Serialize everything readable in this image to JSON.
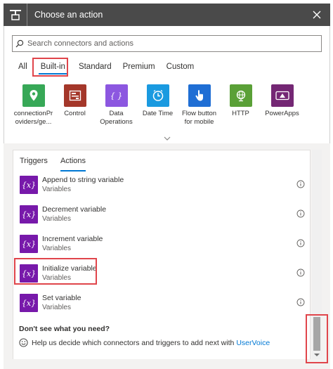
{
  "header": {
    "title": "Choose an action"
  },
  "search": {
    "placeholder": "Search connectors and actions",
    "value": ""
  },
  "category_tabs": [
    {
      "label": "All",
      "active": false
    },
    {
      "label": "Built-in",
      "active": true
    },
    {
      "label": "Standard",
      "active": false
    },
    {
      "label": "Premium",
      "active": false
    },
    {
      "label": "Custom",
      "active": false
    }
  ],
  "connectors": [
    {
      "label": "connectionPr oviders/ge...",
      "icon": "location-pin-icon",
      "color": "#37a857"
    },
    {
      "label": "Control",
      "icon": "control-icon",
      "color": "#a4372a"
    },
    {
      "label": "Data Operations",
      "icon": "data-operations-icon",
      "color": "#8c57e0"
    },
    {
      "label": "Date Time",
      "icon": "clock-icon",
      "color": "#1a9ae0"
    },
    {
      "label": "Flow button for mobile",
      "icon": "touch-hand-icon",
      "color": "#1f6ed4"
    },
    {
      "label": "HTTP",
      "icon": "globe-icon",
      "color": "#5aa037"
    },
    {
      "label": "PowerApps",
      "icon": "powerapps-icon",
      "color": "#742774"
    }
  ],
  "action_tabs": [
    {
      "label": "Triggers",
      "active": false
    },
    {
      "label": "Actions",
      "active": true
    }
  ],
  "actions": [
    {
      "name": "Append to string variable",
      "sub": "Variables"
    },
    {
      "name": "Decrement variable",
      "sub": "Variables"
    },
    {
      "name": "Increment variable",
      "sub": "Variables"
    },
    {
      "name": "Initialize variable",
      "sub": "Variables"
    },
    {
      "name": "Set variable",
      "sub": "Variables"
    }
  ],
  "action_icon_text": "{x}",
  "footer": {
    "question": "Don't see what you need?",
    "help_text": "Help us decide which connectors and triggers to add next with",
    "link": "UserVoice"
  },
  "colors": {
    "accent": "#0078d4",
    "variable_icon": "#7719aa",
    "highlight": "#e0454b"
  }
}
